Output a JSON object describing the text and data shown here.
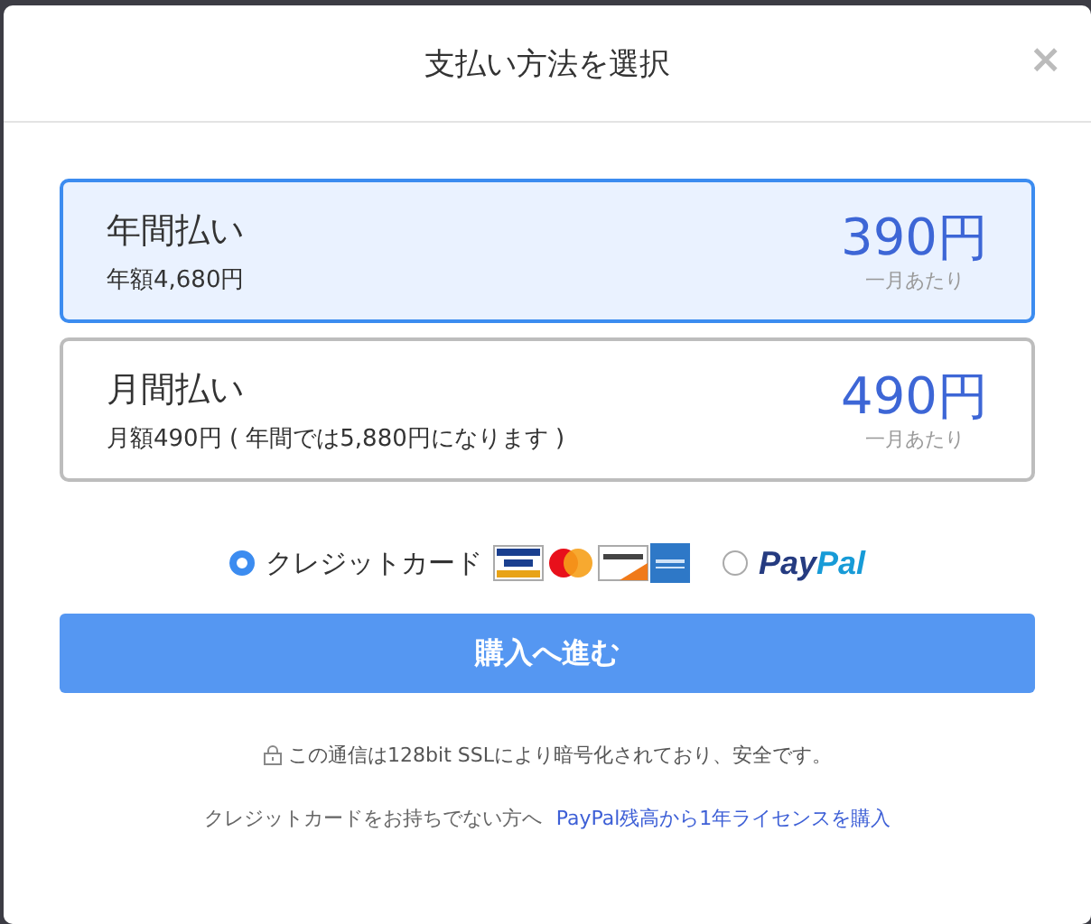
{
  "dialog": {
    "title": "支払い方法を選択",
    "close": "×"
  },
  "plans": [
    {
      "name": "年間払い",
      "detail": "年額4,680円",
      "price": "390円",
      "per": "一月あたり",
      "selected": true
    },
    {
      "name": "月間払い",
      "detail": "月額490円 ( 年間では5,880円になります )",
      "price": "490円",
      "per": "一月あたり",
      "selected": false
    }
  ],
  "payment_methods": [
    {
      "kind": "card",
      "label": "クレジットカード",
      "selected": true
    },
    {
      "kind": "paypal",
      "label": "PayPal",
      "selected": false
    }
  ],
  "submit": "購入へ進む",
  "security_note": "この通信は128bit SSLにより暗号化されており、安全です。",
  "alt_text": "クレジットカードをお持ちでない方へ",
  "alt_link": "PayPal残高から1年ライセンスを購入"
}
